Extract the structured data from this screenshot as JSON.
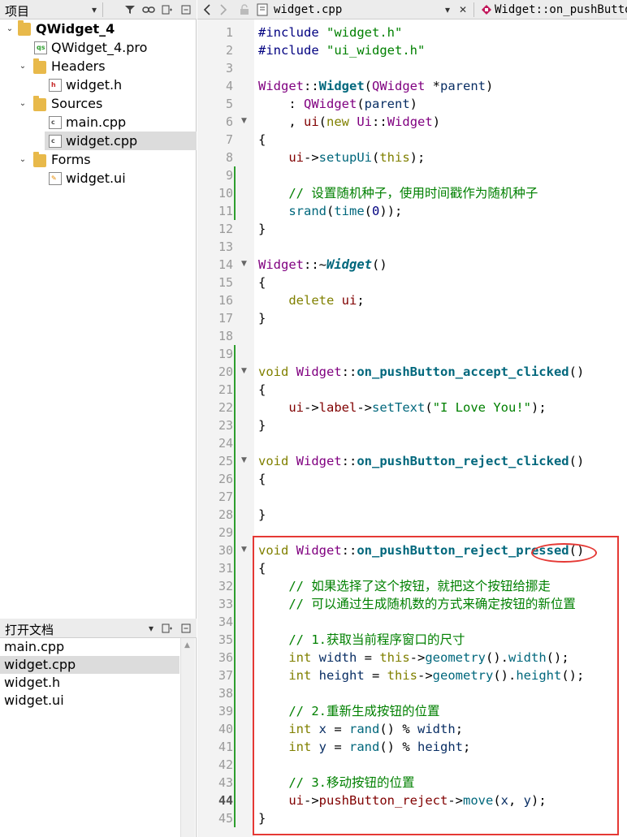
{
  "project_pane": {
    "title": "项目",
    "tree": [
      {
        "label": "QWidget_4",
        "kind": "project"
      },
      {
        "label": "QWidget_4.pro",
        "kind": "pro"
      },
      {
        "label": "Headers",
        "kind": "folder"
      },
      {
        "label": "widget.h",
        "kind": "header"
      },
      {
        "label": "Sources",
        "kind": "folder"
      },
      {
        "label": "main.cpp",
        "kind": "source"
      },
      {
        "label": "widget.cpp",
        "kind": "source",
        "selected": true
      },
      {
        "label": "Forms",
        "kind": "folder"
      },
      {
        "label": "widget.ui",
        "kind": "form"
      }
    ]
  },
  "open_documents": {
    "title": "打开文档",
    "items": [
      "main.cpp",
      "widget.cpp",
      "widget.h",
      "widget.ui"
    ],
    "selected": "widget.cpp"
  },
  "editor": {
    "file_name": "widget.cpp",
    "function_selector": "Widget::on_pushButton",
    "current_line": "44",
    "lines": [
      "1",
      "2",
      "3",
      "4",
      "5",
      "6",
      "7",
      "8",
      "9",
      "10",
      "11",
      "12",
      "13",
      "14",
      "15",
      "16",
      "17",
      "18",
      "19",
      "20",
      "21",
      "22",
      "23",
      "24",
      "25",
      "26",
      "27",
      "28",
      "29",
      "30",
      "31",
      "32",
      "33",
      "34",
      "35",
      "36",
      "37",
      "38",
      "39",
      "40",
      "41",
      "42",
      "43",
      "44",
      "45"
    ],
    "code": {
      "l1": [
        "#include",
        " ",
        "\"widget.h\""
      ],
      "l2": [
        "#include",
        " ",
        "\"ui_widget.h\""
      ],
      "l4": [
        "Widget",
        "::",
        "Widget",
        "(",
        "QWidget",
        " *",
        "parent",
        ")"
      ],
      "l5": [
        "    : ",
        "QWidget",
        "(",
        "parent",
        ")"
      ],
      "l6": [
        "    , ",
        "ui",
        "(",
        "new",
        " ",
        "Ui",
        "::",
        "Widget",
        ")"
      ],
      "l7": [
        "{"
      ],
      "l8": [
        "    ",
        "ui",
        "->",
        "setupUi",
        "(",
        "this",
        ");"
      ],
      "l10": [
        "    // 设置随机种子，使用时间戳作为随机种子"
      ],
      "l11": [
        "    ",
        "srand",
        "(",
        "time",
        "(",
        "0",
        "));"
      ],
      "l12": [
        "}"
      ],
      "l14": [
        "Widget",
        "::~",
        "Widget",
        "()"
      ],
      "l15": [
        "{"
      ],
      "l16": [
        "    ",
        "delete",
        " ",
        "ui",
        ";"
      ],
      "l17": [
        "}"
      ],
      "l20": [
        "void",
        " ",
        "Widget",
        "::",
        "on_pushButton_accept_clicked",
        "()"
      ],
      "l21": [
        "{"
      ],
      "l22": [
        "    ",
        "ui",
        "->",
        "label",
        "->",
        "setText",
        "(",
        "\"I Love You!\"",
        ");"
      ],
      "l23": [
        "}"
      ],
      "l25": [
        "void",
        " ",
        "Widget",
        "::",
        "on_pushButton_reject_clicked",
        "()"
      ],
      "l26": [
        "{"
      ],
      "l28": [
        "}"
      ],
      "l30": [
        "void",
        " ",
        "Widget",
        "::",
        "on_pushButton_reject_pressed",
        "()"
      ],
      "l31": [
        "{"
      ],
      "l32": [
        "    // 如果选择了这个按钮，就把这个按钮给挪走"
      ],
      "l33": [
        "    // 可以通过生成随机数的方式来确定按钮的新位置"
      ],
      "l35": [
        "    // 1.获取当前程序窗口的尺寸"
      ],
      "l36": [
        "    ",
        "int",
        " ",
        "width",
        " = ",
        "this",
        "->",
        "geometry",
        "().",
        "width",
        "();"
      ],
      "l37": [
        "    ",
        "int",
        " ",
        "height",
        " = ",
        "this",
        "->",
        "geometry",
        "().",
        "height",
        "();"
      ],
      "l39": [
        "    // 2.重新生成按钮的位置"
      ],
      "l40": [
        "    ",
        "int",
        " ",
        "x",
        " = ",
        "rand",
        "() % ",
        "width",
        ";"
      ],
      "l41": [
        "    ",
        "int",
        " ",
        "y",
        " = ",
        "rand",
        "() % ",
        "height",
        ";"
      ],
      "l43": [
        "    // 3.移动按钮的位置"
      ],
      "l44": [
        "    ",
        "ui",
        "->",
        "pushButton_reject",
        "->",
        "move",
        "(",
        "x",
        ", ",
        "y",
        ");"
      ],
      "l45": [
        "}"
      ]
    }
  },
  "colors": {
    "annotation_red": "#e53935",
    "comment_green": "#008000",
    "keyword_olive": "#808000",
    "type_purple": "#800080",
    "change_bar_green": "#2e9e2e"
  }
}
